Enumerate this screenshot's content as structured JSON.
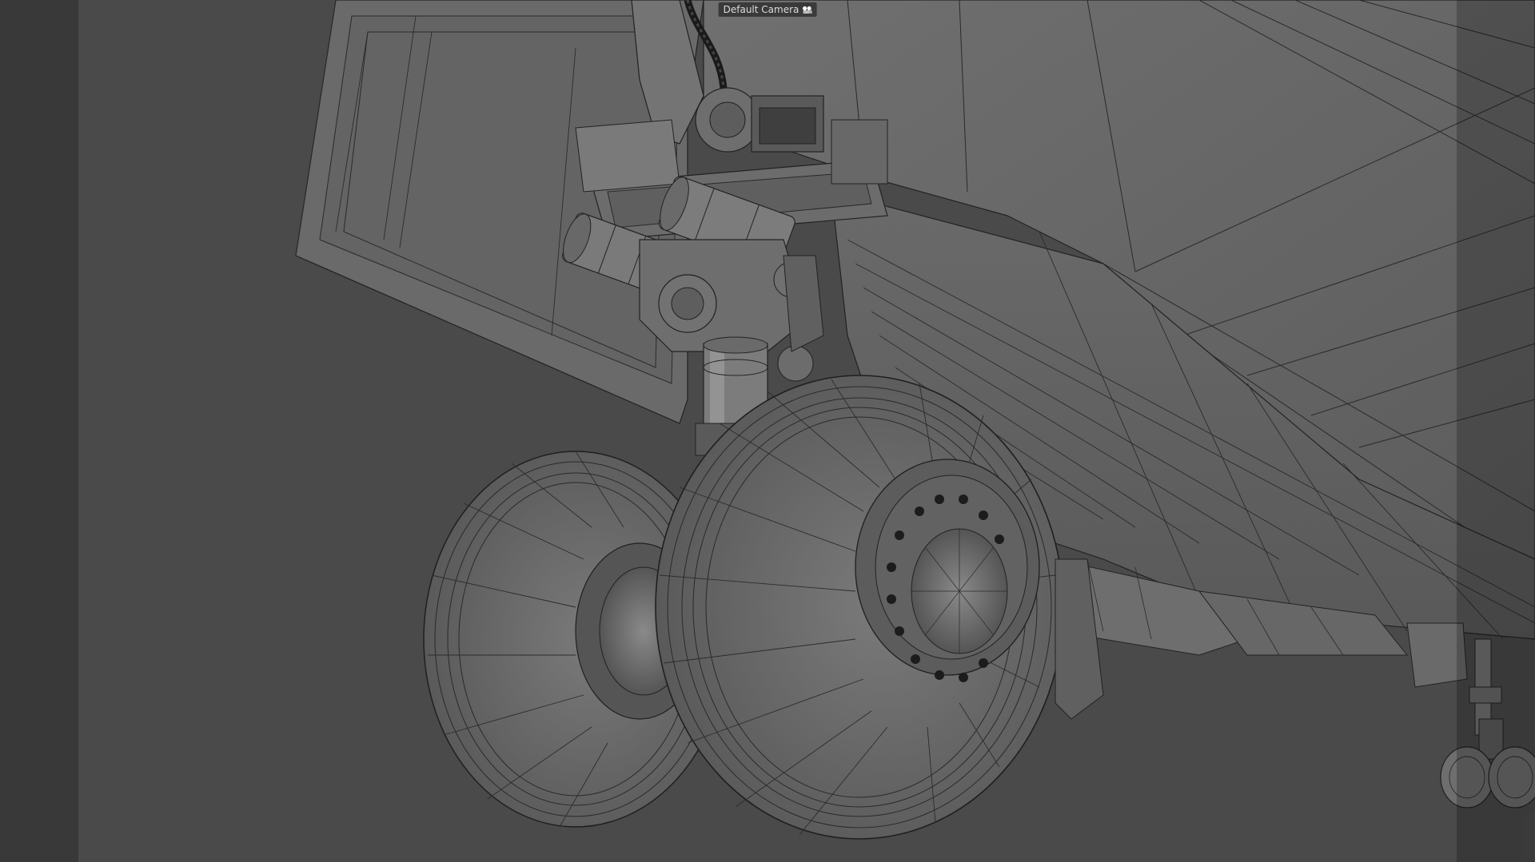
{
  "viewport": {
    "camera_label": "Default Camera",
    "camera_icon": "camera-icon",
    "background_color": "#4a4a4a",
    "safe_frame_color": "#383838"
  },
  "scene": {
    "subject": "aircraft-main-landing-gear-wireframe",
    "shading": "gouraud-with-wireframe"
  }
}
